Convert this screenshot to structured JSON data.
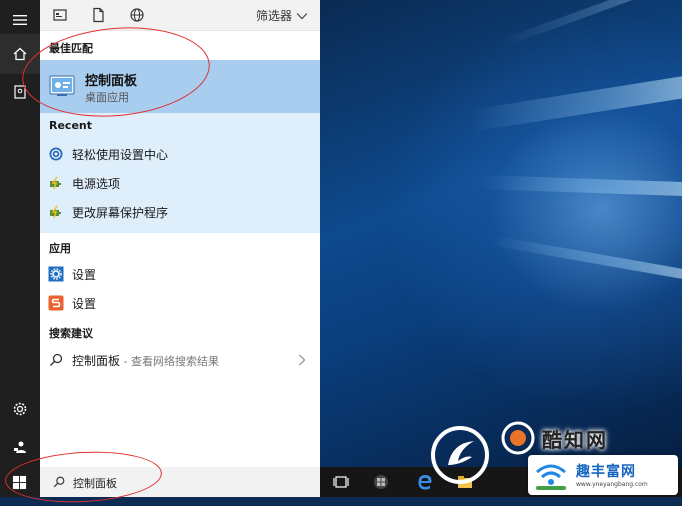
{
  "topbar": {
    "filter_label": "筛选器"
  },
  "sections": {
    "best_match": "最佳匹配",
    "recent": "Recent",
    "apps": "应用",
    "suggestions": "搜索建议"
  },
  "best_match": {
    "title": "控制面板",
    "subtitle": "桌面应用"
  },
  "recent_items": [
    {
      "label": "轻松使用设置中心",
      "icon": "ease-of-access-icon"
    },
    {
      "label": "电源选项",
      "icon": "power-options-icon"
    },
    {
      "label": "更改屏幕保护程序",
      "icon": "screensaver-icon"
    }
  ],
  "app_items": [
    {
      "label": "设置",
      "icon": "settings-gear-icon"
    },
    {
      "label": "设置",
      "icon": "settings-app-icon"
    }
  ],
  "suggestion": {
    "query": "控制面板",
    "hint": " - 查看网络搜索结果"
  },
  "search": {
    "value": "控制面板"
  },
  "watermark": {
    "site_name": "酷知网",
    "badge_name": "趣丰富网",
    "badge_url": "www.yneyangbang.com"
  },
  "colors": {
    "accent": "#0078d7",
    "best_match_bg": "#a9cdef",
    "recent_bg": "#deeefb",
    "rail_bg": "#1f1f1f",
    "annotation": "#e03030"
  }
}
